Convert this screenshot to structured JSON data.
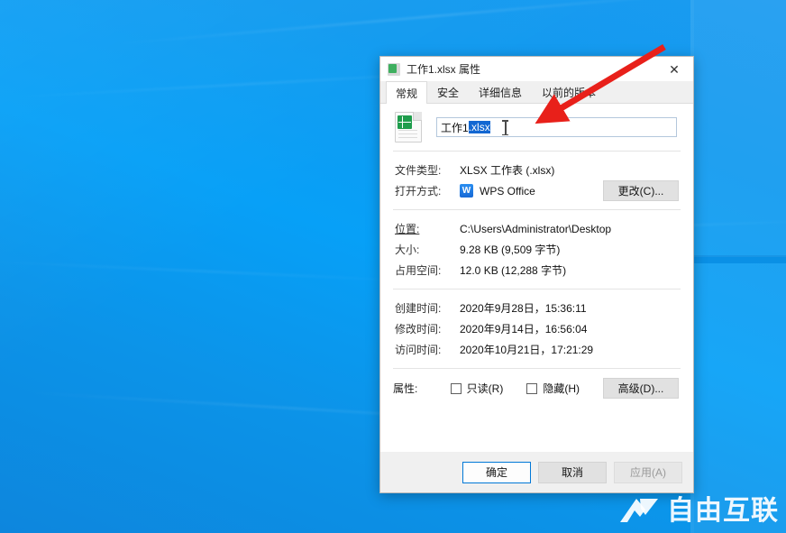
{
  "desktop": {
    "wallpaper_color": "#0b8ce8",
    "watermark": {
      "text": "自由互联",
      "logo_icon": "x-logo-icon"
    }
  },
  "dialog": {
    "title": "工作1.xlsx 属性",
    "title_icon": "xlsx-file-icon",
    "close_icon": "✕",
    "tabs": [
      {
        "label": "常规",
        "active": true
      },
      {
        "label": "安全",
        "active": false
      },
      {
        "label": "详细信息",
        "active": false
      },
      {
        "label": "以前的版本",
        "active": false
      }
    ],
    "name_field": {
      "icon": "xlsx-file-icon",
      "plain_text": "工作1",
      "selected_text": ".xlsx",
      "selection_color": "#1267d2",
      "cursor_icon": "text-cursor-icon"
    },
    "info": {
      "file_type": {
        "label": "文件类型:",
        "value": "XLSX 工作表 (.xlsx)"
      },
      "opens_with": {
        "label": "打开方式:",
        "value": "WPS Office",
        "icon": "wps-office-icon",
        "button": "更改(C)..."
      },
      "location": {
        "label": "位置:",
        "value": "C:\\Users\\Administrator\\Desktop"
      },
      "size": {
        "label": "大小:",
        "value": "9.28 KB (9,509 字节)"
      },
      "size_on_disk": {
        "label": "占用空间:",
        "value": "12.0 KB (12,288 字节)"
      },
      "created": {
        "label": "创建时间:",
        "value": "2020年9月28日，15:36:11"
      },
      "modified": {
        "label": "修改时间:",
        "value": "2020年9月14日，16:56:04"
      },
      "accessed": {
        "label": "访问时间:",
        "value": "2020年10月21日，17:21:29"
      }
    },
    "attributes": {
      "label": "属性:",
      "readonly": {
        "label": "只读(R)",
        "checked": false
      },
      "hidden": {
        "label": "隐藏(H)",
        "checked": false
      },
      "advanced_button": "高级(D)..."
    },
    "footer": {
      "ok": "确定",
      "cancel": "取消",
      "apply": "应用(A)",
      "apply_disabled": true
    }
  },
  "annotation": {
    "arrow_color": "#e8201a",
    "arrow_name": "red-pointer-arrow"
  }
}
